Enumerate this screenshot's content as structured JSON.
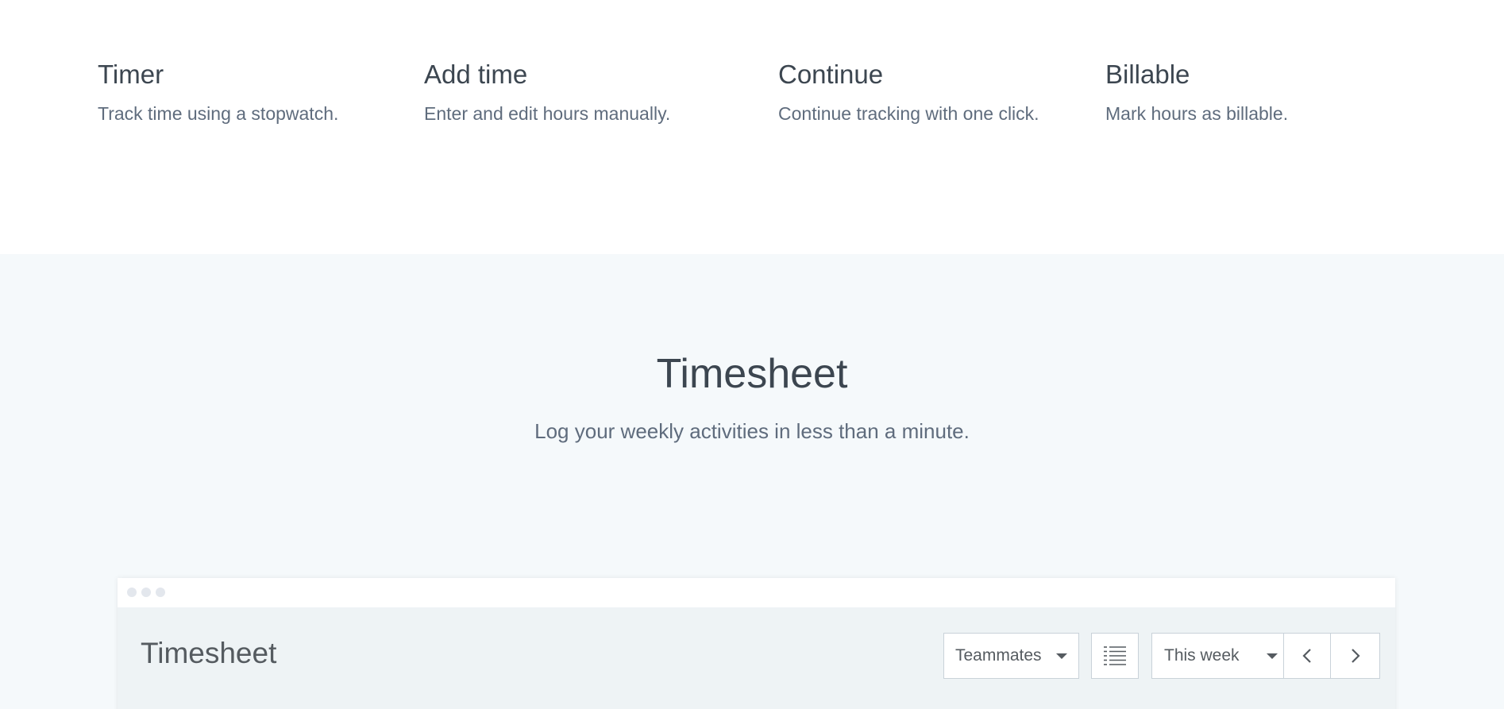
{
  "features": [
    {
      "title": "Timer",
      "description": "Track time using a stopwatch."
    },
    {
      "title": "Add time",
      "description": "Enter and edit hours manually."
    },
    {
      "title": "Continue",
      "description": "Continue tracking with one click."
    },
    {
      "title": "Billable",
      "description": "Mark hours as billable."
    }
  ],
  "promo": {
    "title": "Timesheet",
    "subtitle": "Log your weekly activities in less than a minute."
  },
  "app": {
    "title": "Timesheet",
    "teammates_label": "Teammates",
    "period_label": "This week",
    "icons": {
      "dropdown": "chevron-down-icon",
      "list_view": "list-icon",
      "previous": "chevron-left-icon",
      "next": "chevron-right-icon"
    }
  },
  "colors": {
    "heading": "#3c4650",
    "body_text": "#5f6c7d",
    "promo_background": "#f5f9fb",
    "app_background": "#eef3f5"
  }
}
